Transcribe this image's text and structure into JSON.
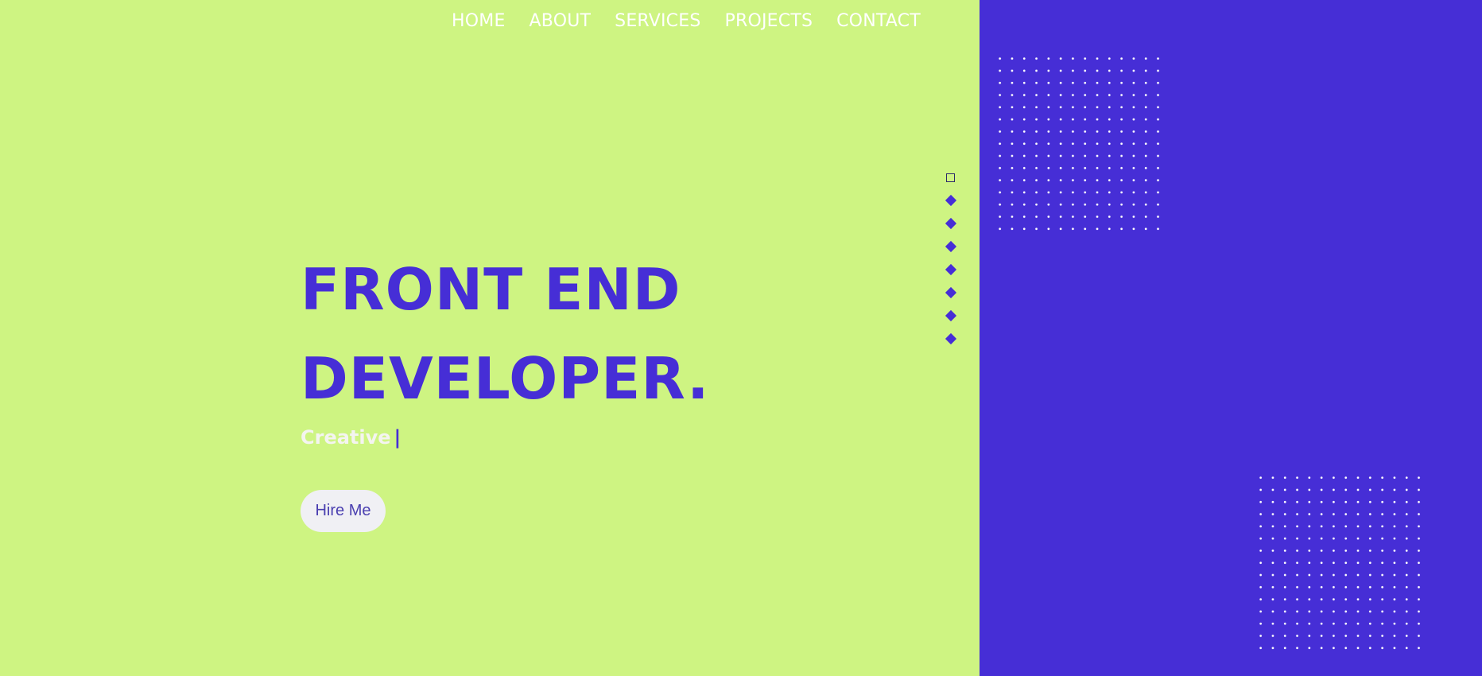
{
  "nav": {
    "items": [
      {
        "label": "HOME"
      },
      {
        "label": "ABOUT"
      },
      {
        "label": "SERVICES"
      },
      {
        "label": "PROJECTS"
      },
      {
        "label": "CONTACT"
      }
    ]
  },
  "hero": {
    "title_line1": "FRONT END",
    "title_line2": "DEVELOPER.",
    "typed_word": "Creative",
    "cursor": "|",
    "hire_button": "Hire Me"
  },
  "slide_indicator": {
    "count": 8,
    "active_index": 0
  },
  "colors": {
    "background_left": "#cef482",
    "background_right": "#462ed6",
    "accent": "#462ed6",
    "text_light": "#ffffff"
  }
}
